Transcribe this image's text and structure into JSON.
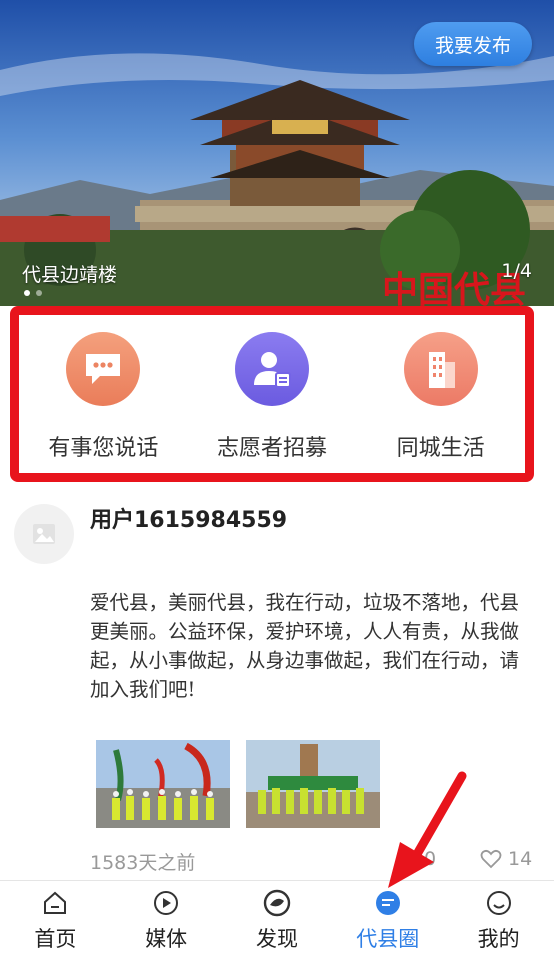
{
  "banner": {
    "publish_label": "我要发布",
    "caption": "代县边靖楼",
    "index": "1/4",
    "overlay_text": "中国代县"
  },
  "quick_actions": [
    {
      "label": "有事您说话",
      "icon": "chat-bubble-icon",
      "color": "#ec8462"
    },
    {
      "label": "志愿者招募",
      "icon": "volunteer-person-icon",
      "color": "#7464e6"
    },
    {
      "label": "同城生活",
      "icon": "building-icon",
      "color": "#ef846c"
    }
  ],
  "post": {
    "username": "用户1615984559",
    "text": "爱代县，美丽代县，我在行动，垃圾不落地，代县更美丽。公益环保，爱护环境，人人有责，从我做起，从小事做起，从身边事做起，我们在行动，请加入我们吧!",
    "time": "1583天之前",
    "comments": "0",
    "likes": "14"
  },
  "nav": {
    "items": [
      {
        "label": "首页",
        "icon": "home-icon"
      },
      {
        "label": "媒体",
        "icon": "play-icon"
      },
      {
        "label": "发现",
        "icon": "discover-icon"
      },
      {
        "label": "代县圈",
        "icon": "message-icon"
      },
      {
        "label": "我的",
        "icon": "smile-icon"
      }
    ],
    "active": "代县圈",
    "active_color": "#2f7fe6"
  },
  "annotation_color": "#e8141c"
}
